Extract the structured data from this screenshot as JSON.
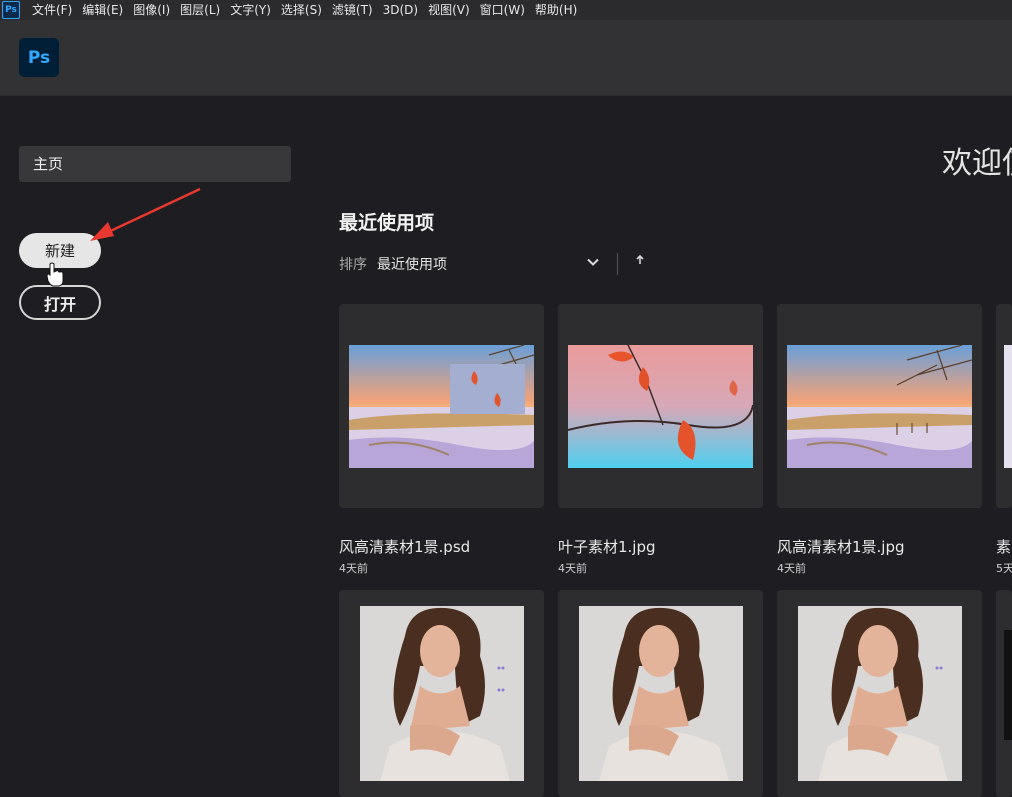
{
  "menubar": {
    "logo": "Ps",
    "items": [
      "文件(F)",
      "编辑(E)",
      "图像(I)",
      "图层(L)",
      "文字(Y)",
      "选择(S)",
      "滤镜(T)",
      "3D(D)",
      "视图(V)",
      "窗口(W)",
      "帮助(H)"
    ]
  },
  "app": {
    "logo": "Ps"
  },
  "sidebar": {
    "home_label": "主页",
    "new_label": "新建",
    "open_label": "打开"
  },
  "main": {
    "welcome": "欢迎使",
    "recent_title": "最近使用项",
    "sort_label": "排序",
    "sort_value": "最近使用项"
  },
  "files": [
    {
      "name": "风高清素材1景.psd",
      "date": "4天前",
      "thumb": "snow-landscape-with-inset"
    },
    {
      "name": "叶子素材1.jpg",
      "date": "4天前",
      "thumb": "red-leaves"
    },
    {
      "name": "风高清素材1景.jpg",
      "date": "4天前",
      "thumb": "snow-landscape"
    },
    {
      "name": "素",
      "date": "5天",
      "thumb": "partial"
    }
  ],
  "colors": {
    "accent": "#31a8ff",
    "background": "#1e1d21",
    "card": "#2d2d30",
    "annotation_arrow": "#e8382f"
  }
}
